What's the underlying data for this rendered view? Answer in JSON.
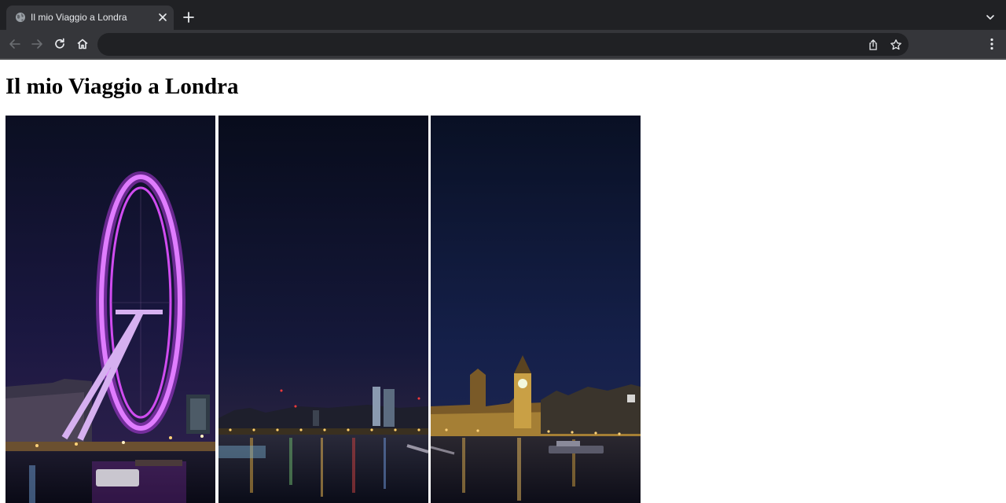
{
  "browser": {
    "tab_title": "Il mio Viaggio a Londra",
    "address_value": "",
    "icons": {
      "favicon": "globe-icon",
      "tab_close": "close-icon",
      "new_tab": "plus-icon",
      "tab_search": "chevron-down-icon",
      "back": "back-arrow-icon",
      "forward": "forward-arrow-icon",
      "reload": "reload-icon",
      "home": "home-icon",
      "share": "share-icon",
      "bookmark": "star-icon",
      "menu": "kebab-menu-icon"
    },
    "colors": {
      "frame": "#202124",
      "toolbar": "#35363a",
      "omnibox": "#202124",
      "icon": "#e8eaed"
    }
  },
  "page": {
    "heading": "Il mio Viaggio a Londra",
    "gallery": [
      {
        "subject": "London Eye at night"
      },
      {
        "subject": "Thames skyline at night"
      },
      {
        "subject": "Big Ben and Westminster at night"
      }
    ]
  }
}
